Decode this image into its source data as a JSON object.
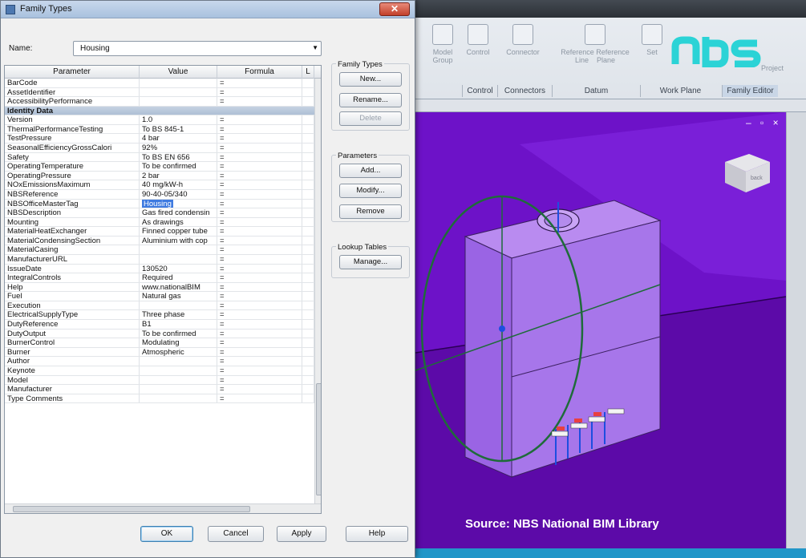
{
  "dialog": {
    "title": "Family Types",
    "close_glyph": "✕",
    "name_label": "Name:",
    "name_value": "Housing",
    "columns": [
      "Parameter",
      "Value",
      "Formula",
      "L"
    ],
    "rows": [
      {
        "param": "BarCode",
        "value": "",
        "formula": "="
      },
      {
        "param": "AssetIdentifier",
        "value": "",
        "formula": "="
      },
      {
        "param": "AccessibilityPerformance",
        "value": "",
        "formula": "="
      },
      {
        "param": "Identity Data",
        "group": true
      },
      {
        "param": "Version",
        "value": "1.0",
        "formula": "="
      },
      {
        "param": "ThermalPerformanceTesting",
        "value": "To BS 845-1",
        "formula": "="
      },
      {
        "param": "TestPressure",
        "value": "4 bar",
        "formula": "="
      },
      {
        "param": "SeasonalEfficiencyGrossCalori",
        "value": "92%",
        "formula": "="
      },
      {
        "param": "Safety",
        "value": "To BS EN 656",
        "formula": "="
      },
      {
        "param": "OperatingTemperature",
        "value": "To be confirmed",
        "formula": "="
      },
      {
        "param": "OperatingPressure",
        "value": "2 bar",
        "formula": "="
      },
      {
        "param": "NOxEmissionsMaximum",
        "value": "40 mg/kW-h",
        "formula": "="
      },
      {
        "param": "NBSReference",
        "value": "90-40-05/340",
        "formula": "="
      },
      {
        "param": "NBSOfficeMasterTag",
        "value": "Housing",
        "formula": "=",
        "selected": true
      },
      {
        "param": "NBSDescription",
        "value": "Gas fired condensin",
        "formula": "="
      },
      {
        "param": "Mounting",
        "value": "As drawings",
        "formula": "="
      },
      {
        "param": "MaterialHeatExchanger",
        "value": "Finned copper tube",
        "formula": "="
      },
      {
        "param": "MaterialCondensingSection",
        "value": "Aluminium with cop",
        "formula": "="
      },
      {
        "param": "MaterialCasing",
        "value": "",
        "formula": "="
      },
      {
        "param": "ManufacturerURL",
        "value": "",
        "formula": "="
      },
      {
        "param": "IssueDate",
        "value": "130520",
        "formula": "="
      },
      {
        "param": "IntegralControls",
        "value": "Required",
        "formula": "="
      },
      {
        "param": "Help",
        "value": "www.nationalBIM",
        "formula": "="
      },
      {
        "param": "Fuel",
        "value": "Natural gas",
        "formula": "="
      },
      {
        "param": "Execution",
        "value": "",
        "formula": "="
      },
      {
        "param": "ElectricalSupplyType",
        "value": "Three phase",
        "formula": "="
      },
      {
        "param": "DutyReference",
        "value": "B1",
        "formula": "="
      },
      {
        "param": "DutyOutput",
        "value": "To be confirmed",
        "formula": "="
      },
      {
        "param": "BurnerControl",
        "value": "Modulating",
        "formula": "="
      },
      {
        "param": "Burner",
        "value": "Atmospheric",
        "formula": "="
      },
      {
        "param": "Author",
        "value": "",
        "formula": "="
      },
      {
        "param": "Keynote",
        "value": "",
        "formula": "="
      },
      {
        "param": "Model",
        "value": "",
        "formula": "="
      },
      {
        "param": "Manufacturer",
        "value": "",
        "formula": "="
      },
      {
        "param": "Type Comments",
        "value": "",
        "formula": "="
      }
    ],
    "family_types": {
      "label": "Family Types",
      "new": "New...",
      "rename": "Rename...",
      "delete": "Delete"
    },
    "parameters": {
      "label": "Parameters",
      "add": "Add...",
      "modify": "Modify...",
      "remove": "Remove"
    },
    "lookup": {
      "label": "Lookup Tables",
      "manage": "Manage..."
    },
    "footer": {
      "ok": "OK",
      "cancel": "Cancel",
      "apply": "Apply",
      "help": "Help"
    }
  },
  "ribbon": {
    "buttons": [
      {
        "label": "Model\nGroup"
      },
      {
        "label": "Control"
      },
      {
        "label": "Connector"
      },
      {
        "label": "Reference Reference\nLine    Plane"
      },
      {
        "label": "Set"
      }
    ],
    "panels": [
      "Control",
      "Connectors",
      "Datum",
      "Work Plane",
      "Family Editor"
    ],
    "project_label": "Project"
  },
  "viewport": {
    "window_controls": "– ▫ ×",
    "caption": "Source: NBS National BIM Library",
    "logo_text": "nbs",
    "viewcube_label": "back",
    "bg_color": "#6d12c8",
    "accent_color": "#2bd3d6"
  }
}
